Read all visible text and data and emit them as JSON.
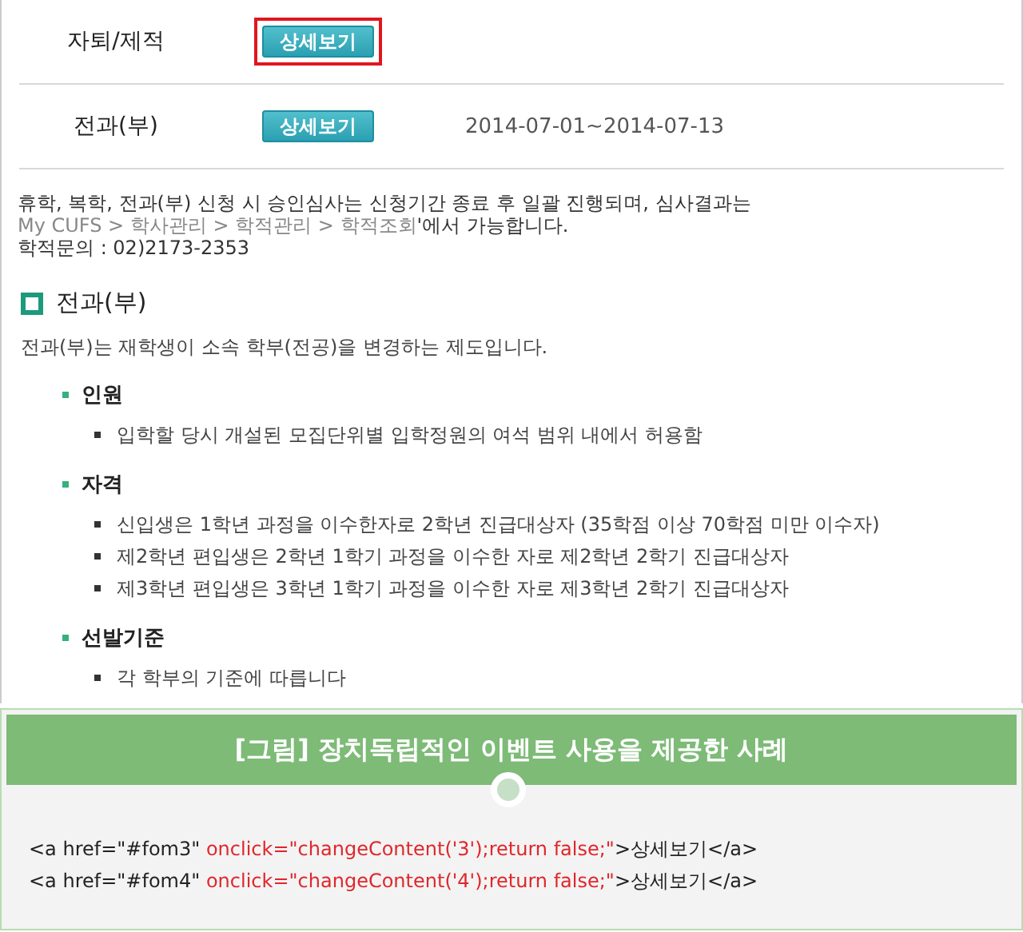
{
  "rows": [
    {
      "label": "자퇴/제적",
      "button": "상세보기",
      "highlighted": true
    },
    {
      "label": "전과(부)",
      "button": "상세보기",
      "highlighted": false,
      "period": "2014-07-01~2014-07-13"
    }
  ],
  "notice": [
    [
      {
        "kind": "plain",
        "text": "휴학, 복학, 전과(부) 신청 시 승인심사는 신청기간 종료 후 일괄 진행되며, 심사결과는"
      }
    ],
    [
      {
        "kind": "muted",
        "text": "My CUFS > 학사관리 > 학적관리 > 학적조회"
      },
      {
        "kind": "plain",
        "text": "'에서 가능합니다."
      }
    ],
    [
      {
        "kind": "plain",
        "text": "학적문의 : 02)2173-2353"
      }
    ]
  ],
  "section": {
    "title": "전과(부)",
    "intro": "전과(부)는 재학생이 소속 학부(전공)을 변경하는 제도입니다.",
    "groups": [
      {
        "title": "인원",
        "items": [
          "입학할 당시 개설된 모집단위별 입학정원의 여석 범위 내에서 허용함"
        ]
      },
      {
        "title": "자격",
        "items": [
          "신입생은 1학년 과정을 이수한자로 2학년 진급대상자 (35학점 이상 70학점 미만 이수자)",
          "제2학년 편입생은 2학년 1학기 과정을 이수한 자로 제2학년 2학기 진급대상자",
          "제3학년 편입생은 3학년 1학기 과정을 이수한 자로 제3학년 2학기 진급대상자"
        ]
      },
      {
        "title": "선발기준",
        "items": [
          "각 학부의 기준에 따릅니다"
        ]
      }
    ]
  },
  "figure": {
    "caption": "[그림] 장치독립적인 이벤트 사용을 제공한 사례",
    "code": [
      [
        {
          "kind": "plain",
          "text": "<a href=\"#fom3\" "
        },
        {
          "kind": "attr",
          "text": "onclick=\"changeContent('3');return false;\""
        },
        {
          "kind": "plain",
          "text": ">상세보기</a>"
        }
      ],
      [
        {
          "kind": "plain",
          "text": "<a href=\"#fom4\" "
        },
        {
          "kind": "attr",
          "text": "onclick=\"changeContent('4');return false;\""
        },
        {
          "kind": "plain",
          "text": ">상세보기</a>"
        }
      ]
    ]
  }
}
